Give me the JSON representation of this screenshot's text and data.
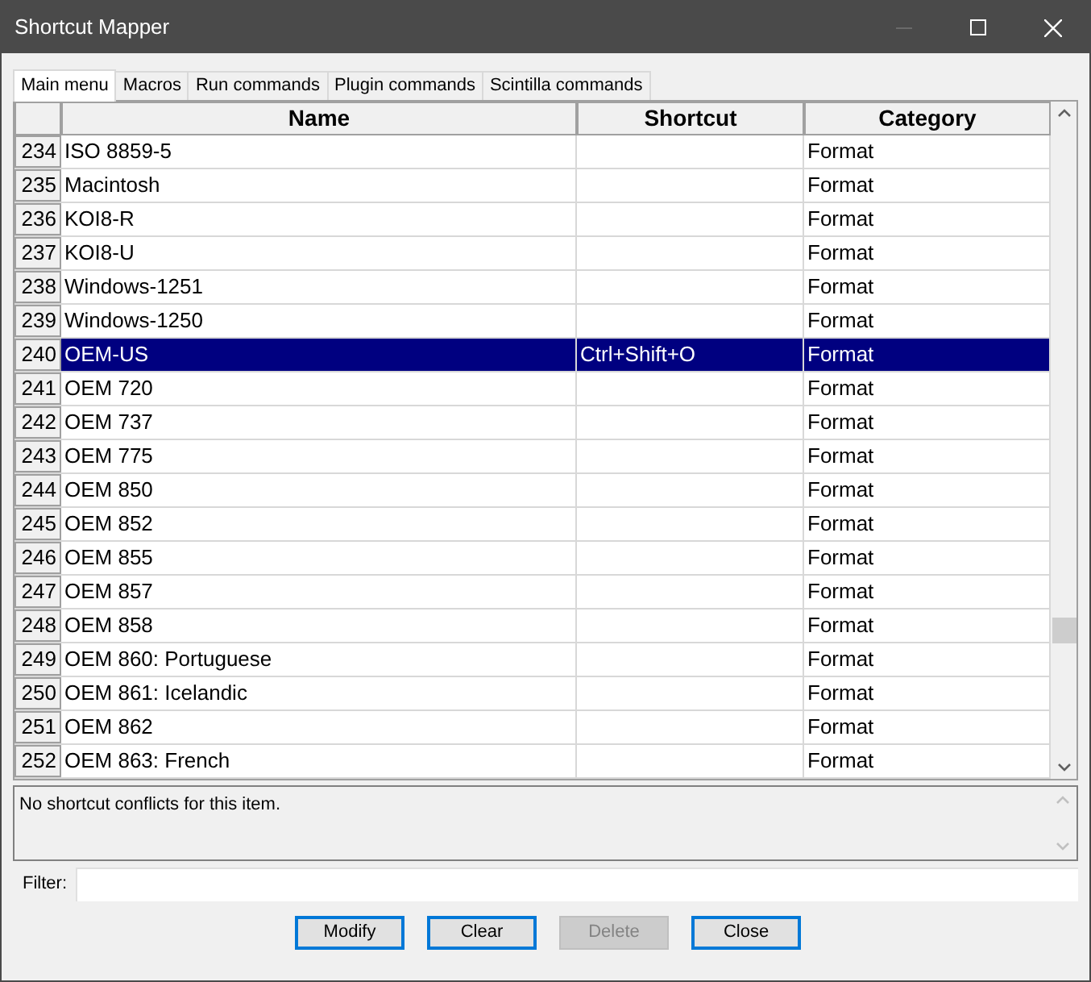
{
  "window": {
    "title": "Shortcut Mapper"
  },
  "tabs": [
    {
      "label": "Main menu",
      "selected": true
    },
    {
      "label": "Macros",
      "selected": false
    },
    {
      "label": "Run commands",
      "selected": false
    },
    {
      "label": "Plugin commands",
      "selected": false
    },
    {
      "label": "Scintilla commands",
      "selected": false
    }
  ],
  "table": {
    "columns": [
      "Name",
      "Shortcut",
      "Category"
    ],
    "rows": [
      {
        "number": "234",
        "name": "ISO 8859-5",
        "category": "Format",
        "selected": false
      },
      {
        "number": "235",
        "name": "Macintosh",
        "category": "Format",
        "selected": false
      },
      {
        "number": "236",
        "name": "KOI8-R",
        "category": "Format",
        "selected": false
      },
      {
        "number": "237",
        "name": "KOI8-U",
        "category": "Format",
        "selected": false
      },
      {
        "number": "238",
        "name": "Windows-1251",
        "category": "Format",
        "selected": false
      },
      {
        "number": "239",
        "name": "Windows-1250",
        "category": "Format",
        "selected": false
      },
      {
        "number": "240",
        "name": "OEM-US",
        "shortcut": "Ctrl+Shift+O",
        "category": "Format",
        "selected": true
      },
      {
        "number": "241",
        "name": "OEM 720",
        "category": "Format",
        "selected": false
      },
      {
        "number": "242",
        "name": "OEM 737",
        "category": "Format",
        "selected": false
      },
      {
        "number": "243",
        "name": "OEM 775",
        "category": "Format",
        "selected": false
      },
      {
        "number": "244",
        "name": "OEM 850",
        "category": "Format",
        "selected": false
      },
      {
        "number": "245",
        "name": "OEM 852",
        "category": "Format",
        "selected": false
      },
      {
        "number": "246",
        "name": "OEM 855",
        "category": "Format",
        "selected": false
      },
      {
        "number": "247",
        "name": "OEM 857",
        "category": "Format",
        "selected": false
      },
      {
        "number": "248",
        "name": "OEM 858",
        "category": "Format",
        "selected": false
      },
      {
        "number": "249",
        "name": "OEM 860: Portuguese",
        "category": "Format",
        "selected": false
      },
      {
        "number": "250",
        "name": "OEM 861: Icelandic",
        "category": "Format",
        "selected": false
      },
      {
        "number": "251",
        "name": "OEM 862",
        "category": "Format",
        "selected": false
      },
      {
        "number": "252",
        "name": "OEM 863: French",
        "category": "Format",
        "selected": false
      }
    ]
  },
  "conflicts": {
    "text": "No shortcut conflicts for this item."
  },
  "filter": {
    "label": "Filter:"
  },
  "buttons": [
    {
      "label": "Modify",
      "disabled": false
    },
    {
      "label": "Clear",
      "disabled": false
    },
    {
      "label": "Delete",
      "disabled": true
    },
    {
      "label": "Close",
      "disabled": false
    }
  ]
}
